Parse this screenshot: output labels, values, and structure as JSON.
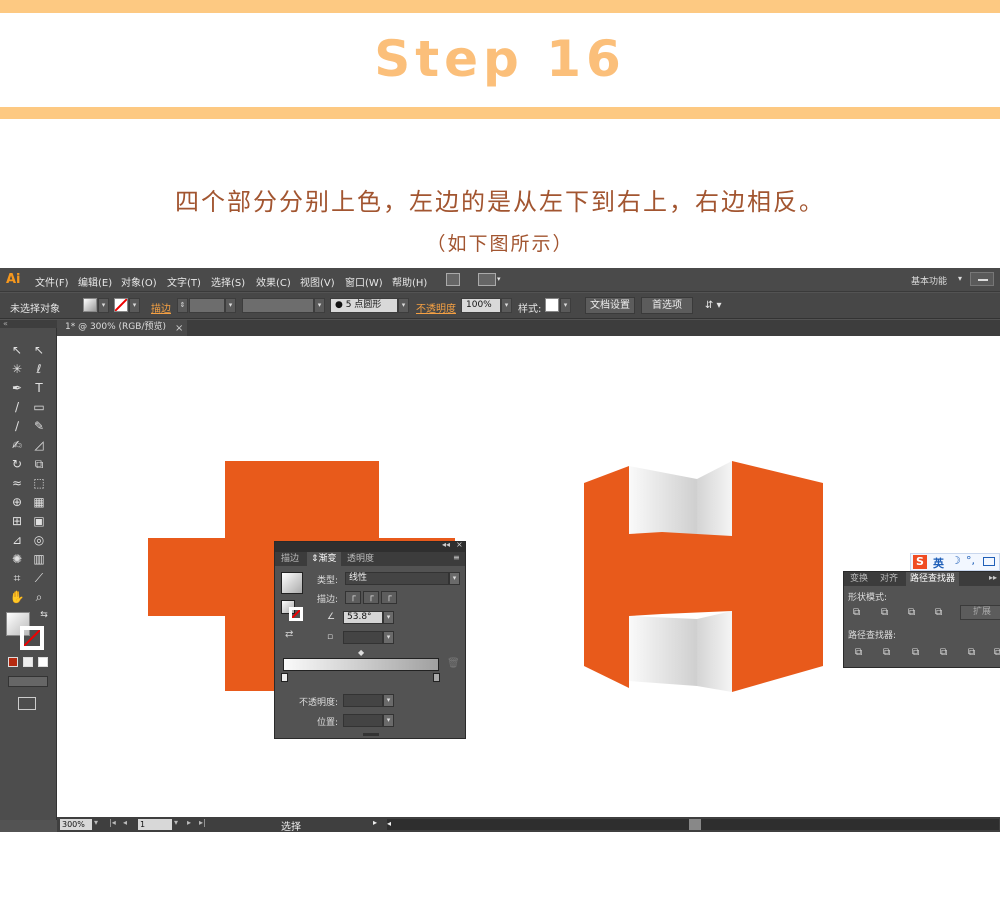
{
  "header": {
    "step_title": "Step 16",
    "instruction": "四个部分分别上色，左边的是从左下到右上，右边相反。",
    "instruction_sub": "（如下图所示）"
  },
  "menubar": {
    "logo": "Ai",
    "items": [
      "文件(F)",
      "编辑(E)",
      "对象(O)",
      "文字(T)",
      "选择(S)",
      "效果(C)",
      "视图(V)",
      "窗口(W)",
      "帮助(H)"
    ],
    "workspace": "基本功能"
  },
  "control_bar": {
    "selection_status": "未选择对象",
    "stroke_label": "描边",
    "brush_label": "5 点圆形",
    "opacity_label": "不透明度",
    "opacity_value": "100%",
    "style_label": "样式",
    "doc_setup_button": "文档设置",
    "prefs_button": "首选项"
  },
  "document_tab": {
    "title": "1* @ 300% (RGB/预览)",
    "close": "×"
  },
  "statusbar": {
    "zoom": "300%",
    "page": "1",
    "tool_status": "选择"
  },
  "gradient_panel": {
    "tabs": [
      "描边",
      "渐变",
      "透明度"
    ],
    "active_tab": "渐变",
    "type_label": "类型:",
    "type_value": "线性",
    "stroke_label": "描边:",
    "angle_value": "53.8°",
    "opacity_label": "不透明度:",
    "location_label": "位置:"
  },
  "pathfinder_panel": {
    "tabs": [
      "变换",
      "对齐",
      "路径查找器"
    ],
    "active_tab": "路径查找器",
    "shape_modes_label": "形状模式:",
    "pathfinders_label": "路径查找器:",
    "expand_button": "扩展"
  },
  "ime_bar": {
    "label": "英"
  },
  "colors": {
    "accent_orange": "#e85a1b",
    "header_band": "#fdc982",
    "title_color": "#fbbf7a",
    "instruction_color": "#a25530"
  }
}
